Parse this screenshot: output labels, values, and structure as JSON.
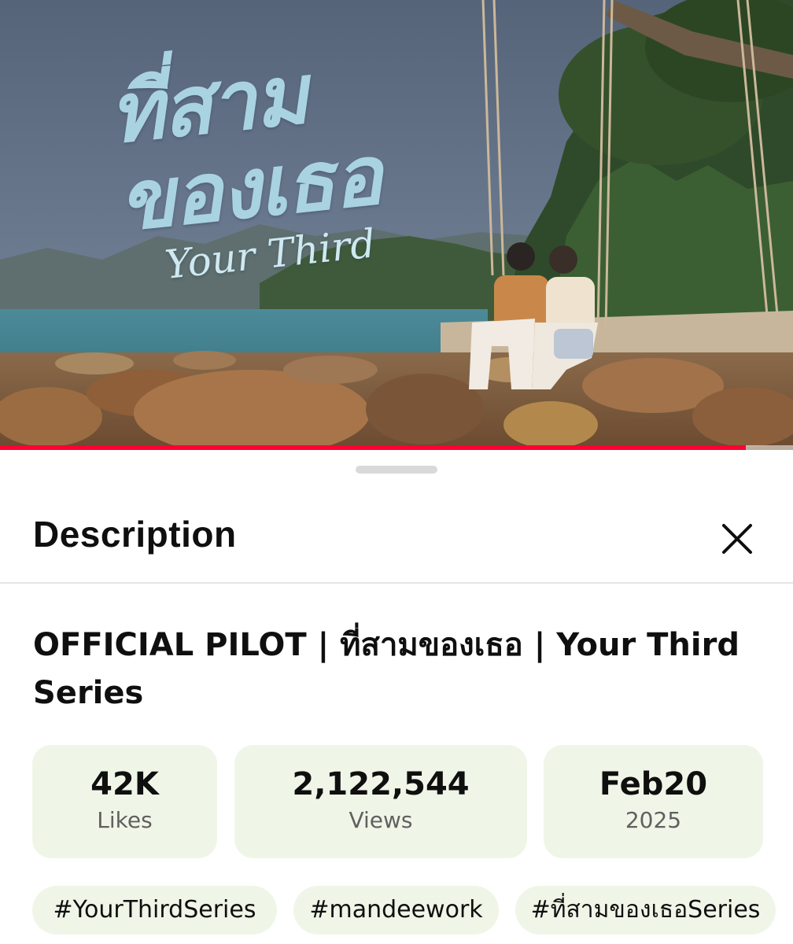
{
  "video": {
    "title_art_thai": "ที่สามของเธอ",
    "title_art_english": "Your Third",
    "progress_fraction": 0.94,
    "progress_color": "#ff0033"
  },
  "sheet": {
    "title": "Description",
    "close_icon": "close-icon"
  },
  "video_title": "OFFICIAL PILOT | ที่สามของเธอ | Your Third Series",
  "stats": {
    "likes": {
      "value": "42K",
      "label": "Likes"
    },
    "views": {
      "value": "2,122,544",
      "label": "Views"
    },
    "date": {
      "value": "Feb20",
      "label": "2025"
    }
  },
  "hashtags": [
    "#YourThirdSeries",
    "#mandeework",
    "#ที่สามของเธอSeries"
  ],
  "colors": {
    "chip_background": "#f0f6e7",
    "secondary_text": "#606060",
    "divider": "#e5e5e5"
  }
}
